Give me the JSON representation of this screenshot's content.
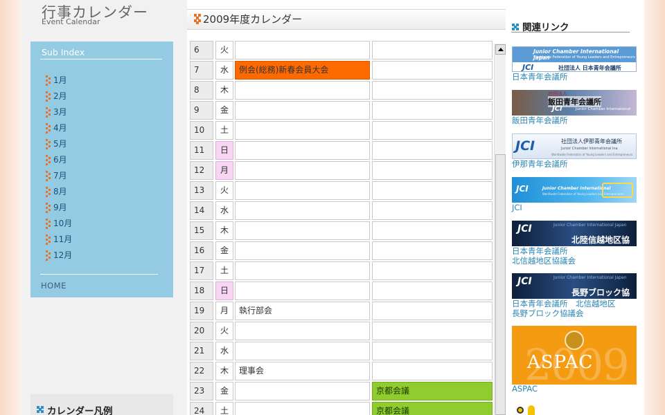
{
  "left": {
    "title_jp": "行事カレンダー",
    "title_en": "Event Calendar",
    "sub_index": "Sub Index",
    "months": [
      "1月",
      "2月",
      "3月",
      "4月",
      "5月",
      "6月",
      "7月",
      "8月",
      "9月",
      "10月",
      "11月",
      "12月"
    ],
    "home": "HOME",
    "legend_title": "カレンダー凡例"
  },
  "calendar": {
    "title": "2009年度カレンダー",
    "rows": [
      {
        "day": "6",
        "wd": "火",
        "ev1": "",
        "ev2": ""
      },
      {
        "day": "7",
        "wd": "水",
        "ev1": "例会(総務)新春会員大会",
        "ev2": ""
      },
      {
        "day": "8",
        "wd": "木",
        "ev1": "",
        "ev2": ""
      },
      {
        "day": "9",
        "wd": "金",
        "ev1": "",
        "ev2": ""
      },
      {
        "day": "10",
        "wd": "土",
        "ev1": "",
        "ev2": ""
      },
      {
        "day": "11",
        "wd": "日",
        "ev1": "",
        "ev2": ""
      },
      {
        "day": "12",
        "wd": "月",
        "ev1": "",
        "ev2": ""
      },
      {
        "day": "13",
        "wd": "火",
        "ev1": "",
        "ev2": ""
      },
      {
        "day": "14",
        "wd": "水",
        "ev1": "",
        "ev2": ""
      },
      {
        "day": "15",
        "wd": "木",
        "ev1": "",
        "ev2": ""
      },
      {
        "day": "16",
        "wd": "金",
        "ev1": "",
        "ev2": ""
      },
      {
        "day": "17",
        "wd": "土",
        "ev1": "",
        "ev2": ""
      },
      {
        "day": "18",
        "wd": "日",
        "ev1": "",
        "ev2": ""
      },
      {
        "day": "19",
        "wd": "月",
        "ev1": "執行部会",
        "ev2": ""
      },
      {
        "day": "20",
        "wd": "火",
        "ev1": "",
        "ev2": ""
      },
      {
        "day": "21",
        "wd": "水",
        "ev1": "",
        "ev2": ""
      },
      {
        "day": "22",
        "wd": "木",
        "ev1": "理事会",
        "ev2": ""
      },
      {
        "day": "23",
        "wd": "金",
        "ev1": "",
        "ev2": "京都会議"
      },
      {
        "day": "24",
        "wd": "土",
        "ev1": "",
        "ev2": "京都会議"
      }
    ]
  },
  "right": {
    "links_title": "関連リンク",
    "banners": [
      {
        "id": "jci-japan",
        "caption": "日本青年会議所",
        "img_lines": [
          "Junior Chamber International Japan",
          "Worldwide Federation of Young Leaders and Entrepreneurs",
          "JCI",
          "社団法人 日本青年会議所"
        ]
      },
      {
        "id": "iida",
        "caption": "飯田青年会議所",
        "img_lines": [
          "社団法人",
          "飯田青年会議所",
          "JCI",
          "Junior Chamber International"
        ]
      },
      {
        "id": "ina",
        "caption": "伊那青年会議所",
        "img_lines": [
          "JCI",
          "社団法人伊那青年会議所",
          "Junior Chamber International Ina",
          "Worldwide Federation of Young Leaders and Entrepreneurs"
        ]
      },
      {
        "id": "jci",
        "caption": "JCI",
        "img_lines": [
          "JCI",
          "Junior Chamber International",
          "Worldwide Federation of Young Leaders and Entrepreneurs"
        ]
      },
      {
        "id": "hokushinetsu",
        "caption": "日本青年会議所 北信越地区協議会",
        "caption_lines": [
          "日本青年会議所",
          "北信越地区協議会"
        ],
        "img_lines": [
          "JCI",
          "Junior Chamber International Japan",
          "北陸信越地区協議会"
        ]
      },
      {
        "id": "nagano",
        "caption": "日本青年会議所 北信越地区 長野ブロック協議会",
        "caption_lines": [
          "日本青年会議所　北信越地区",
          "長野ブロック協議会"
        ],
        "img_lines": [
          "JCI",
          "Junior Chamber International Japan",
          "長野ブロック協議会"
        ]
      },
      {
        "id": "aspac",
        "caption": "ASPAC",
        "img_lines": [
          "2009",
          "ASPAC"
        ]
      }
    ]
  },
  "colors": {
    "orange_event": "#ff6a00",
    "green_event": "#8fcc2e",
    "holiday": "#f8d5f2",
    "subindex_bg": "#94cbe2",
    "link": "#2a86b5"
  }
}
